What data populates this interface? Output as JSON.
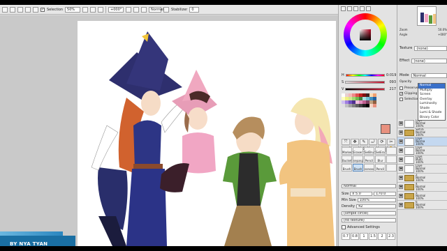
{
  "toolbar": {
    "selection_label": "Selection",
    "zoom_value": "50%",
    "angle_value": "+000°",
    "blend_value": "Normal",
    "stabilizer_label": "Stabilizer",
    "stabilizer_value": "0"
  },
  "watermark": {
    "text": "BY NYA TYAN"
  },
  "color_panel": {
    "slider_h_label": "H",
    "slider_h_value": "0:019",
    "slider_s_label": "S",
    "slider_s_value": "093",
    "slider_v_label": "V",
    "slider_v_value": "217",
    "swatch_colors": [
      "#ffffff",
      "#e8d0d0",
      "#f4b8b8",
      "#f08888",
      "#e05050",
      "#c02020",
      "#801010",
      "#402020",
      "#ffd8b0",
      "#f0a070",
      "#ffffc0",
      "#f0f080",
      "#d0e890",
      "#a0d870",
      "#70b850",
      "#408040",
      "#a8e0e0",
      "#70c0d0",
      "#4090c0",
      "#2060a0",
      "#d0c0f0",
      "#a080e0",
      "#7050c0",
      "#503090",
      "#f0c0e0",
      "#e090c0",
      "#c06090",
      "#804060",
      "#c0a080",
      "#906040",
      "#e0e0e0",
      "#c0c0c0",
      "#a0a0a0",
      "#808080",
      "#606060",
      "#404040",
      "#202020",
      "#000000",
      "#f4d2c4",
      "#e8917f"
    ],
    "tools": [
      "⤧",
      "✥",
      "✎",
      "⤾",
      "⟳",
      "✂",
      "⬚",
      "◍",
      "↕",
      "⊞",
      "◎",
      "✋"
    ],
    "brushes": [
      {
        "label": "Marker",
        "selected": false
      },
      {
        "label": "Eraser",
        "selected": false
      },
      {
        "label": "SelBrush",
        "selected": false
      },
      {
        "label": "SelErase",
        "selected": false
      },
      {
        "label": "",
        "selected": false
      },
      {
        "label": "Bucket",
        "selected": false
      },
      {
        "label": "sepaspe",
        "selected": false
      },
      {
        "label": "Pencil",
        "selected": false
      },
      {
        "label": "Blur",
        "selected": false
      },
      {
        "label": "",
        "selected": false
      },
      {
        "label": "Brush",
        "selected": false
      },
      {
        "label": "Brush",
        "selected": true
      },
      {
        "label": "sonoou",
        "selected": false
      },
      {
        "label": "Pencil",
        "selected": false
      },
      {
        "label": "",
        "selected": false
      }
    ],
    "mode_value": "Normal",
    "size_label": "Size",
    "size_mult": "x 5.0",
    "size_value": "170.0",
    "min_size_label": "Min Size",
    "min_size_value": "100%",
    "density_label": "Density",
    "density_value": "42",
    "shape_value": "(simple circle)",
    "texture_value": "(no texture)",
    "advanced_label": "Advanced Settings",
    "size_cells": [
      "0.7",
      "0.8",
      "1",
      "1.5",
      "2",
      "2.3"
    ]
  },
  "layer_panel": {
    "zoom_label": "Zoom",
    "zoom_value": "50.0%",
    "angle_label": "Angle",
    "angle_value": "+000°",
    "texture_label": "Texture",
    "texture_value": "(none)",
    "effect_label": "Effect",
    "effect_value": "(none)",
    "mode_label": "Mode",
    "mode_value": "Normal",
    "opacity_label": "Opacity",
    "preserve_label": "Preserve",
    "clipping_label": "Clipping G",
    "selection_label": "Selection",
    "blend_modes": [
      {
        "label": "Normal",
        "selected": true
      },
      {
        "label": "Multiply",
        "selected": false
      },
      {
        "label": "Screen",
        "selected": false
      },
      {
        "label": "Overlay",
        "selected": false
      },
      {
        "label": "Luminosity",
        "selected": false
      },
      {
        "label": "Shade",
        "selected": false
      },
      {
        "label": "Lumi & Shade",
        "selected": false
      },
      {
        "label": "Binary Color",
        "selected": false
      }
    ],
    "layers": [
      {
        "name": "Laye",
        "mode": "Normal",
        "opacity": "100%",
        "folder": false,
        "selected": false
      },
      {
        "name": "Set16",
        "mode": "Normal",
        "opacity": "100%",
        "folder": true,
        "selected": false
      },
      {
        "name": "Laye",
        "mode": "Norma",
        "opacity": "100%",
        "folder": false,
        "selected": true
      },
      {
        "name": "Laye",
        "mode": "Norma",
        "opacity": "100%",
        "folder": false,
        "selected": false
      },
      {
        "name": "Laye",
        "mode": "Multi",
        "opacity": "100%",
        "folder": false,
        "selected": false
      },
      {
        "name": "Laye",
        "mode": "Normal",
        "opacity": "100%",
        "folder": false,
        "selected": false
      },
      {
        "name": "2",
        "mode": "Normal",
        "opacity": "100%",
        "folder": true,
        "selected": false
      },
      {
        "name": "4",
        "mode": "Normal",
        "opacity": "100%",
        "folder": true,
        "selected": false
      },
      {
        "name": "5",
        "mode": "Normal",
        "opacity": "100%",
        "folder": true,
        "selected": false
      },
      {
        "name": "6",
        "mode": "Normal",
        "opacity": "100%",
        "folder": true,
        "selected": false
      }
    ]
  }
}
